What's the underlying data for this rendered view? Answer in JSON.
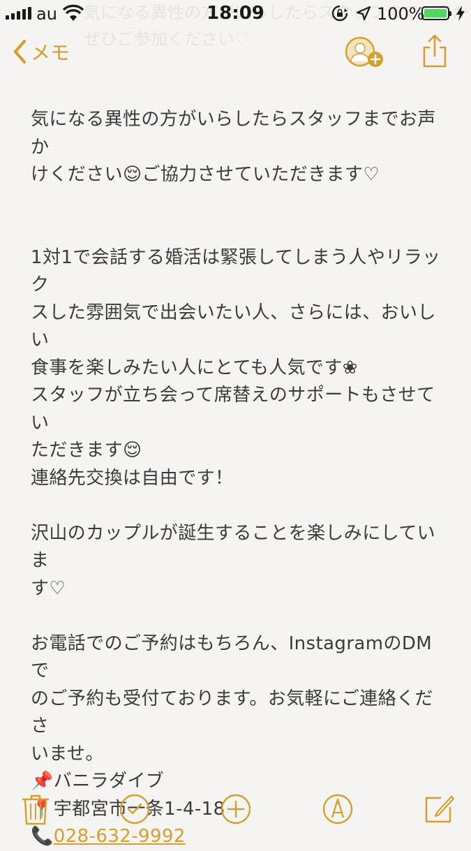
{
  "status_bar": {
    "carrier": "au",
    "time": "18:09",
    "battery_percent": "100%",
    "battery_level": 1.0,
    "ghost_text_line1": "気になる異性の方がいらしたらスタッフまでお声かけください",
    "ghost_text_line2": "ぜひご参加ください♡"
  },
  "nav": {
    "back_label": "メモ",
    "icons": {
      "back": "chevron-left-icon",
      "add_person": "add-person-icon",
      "share": "share-icon"
    }
  },
  "note": {
    "paragraphs": [
      {
        "lines": [
          "気になる異性の方がいらしたらスタッフまでお声か",
          "けください😌ご協力させていただきます♡"
        ]
      },
      {
        "blank": true
      },
      {
        "blank": true
      },
      {
        "lines": [
          "1対1で会話する婚活は緊張してしまう人やリラック",
          "スした雰囲気で出会いたい人、さらには、おいしい",
          "食事を楽しみたい人にとても人気です❀",
          "スタッフが立ち会って席替えのサポートもさせてい",
          "ただきます😌",
          "連絡先交換は自由です！"
        ]
      },
      {
        "blank": true
      },
      {
        "lines": [
          "沢山のカップルが誕生することを楽しみにしていま",
          "す♡"
        ]
      },
      {
        "blank": true
      },
      {
        "lines": [
          "お電話でのご予約はもちろん、InstagramのDMで",
          "のご予約も受付ております。お気軽にご連絡くださ",
          "いませ。"
        ]
      },
      {
        "lines": [
          "📌バニラダイブ",
          "📍宇都宮市一条1-4-18"
        ]
      }
    ],
    "phone_prefix": "📞",
    "phone_number": "028-632-9992"
  },
  "toolbar": {
    "icons": [
      "trash-icon",
      "checklist-icon",
      "add-icon",
      "markup-icon",
      "compose-icon"
    ]
  },
  "colors": {
    "accent": "#d4a02c",
    "text": "#3b3b3b",
    "background": "#f6f5f3",
    "battery_fill": "#4cd964"
  }
}
